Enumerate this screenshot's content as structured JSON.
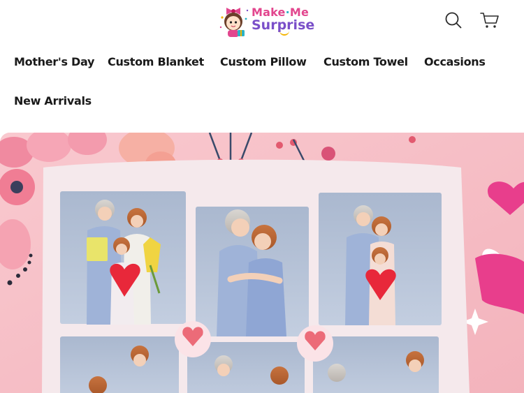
{
  "brand": {
    "line1_a": "Make",
    "line1_dot": "·",
    "line1_b": "Me",
    "line2": "Surprise"
  },
  "header": {
    "search_icon": "search-icon",
    "cart_icon": "cart-icon"
  },
  "nav": {
    "items": [
      {
        "label": "Mother's Day"
      },
      {
        "label": "Custom Blanket"
      },
      {
        "label": "Custom Pillow"
      },
      {
        "label": "Custom Towel"
      },
      {
        "label": "Occasions"
      },
      {
        "label": "New Arrivals"
      }
    ]
  },
  "hero": {
    "image": "mothers-day-photo-collage-blanket",
    "colors": {
      "background": "#f7c2c8",
      "heart": "#e8283a",
      "accent_pink": "#e83e8c"
    }
  }
}
